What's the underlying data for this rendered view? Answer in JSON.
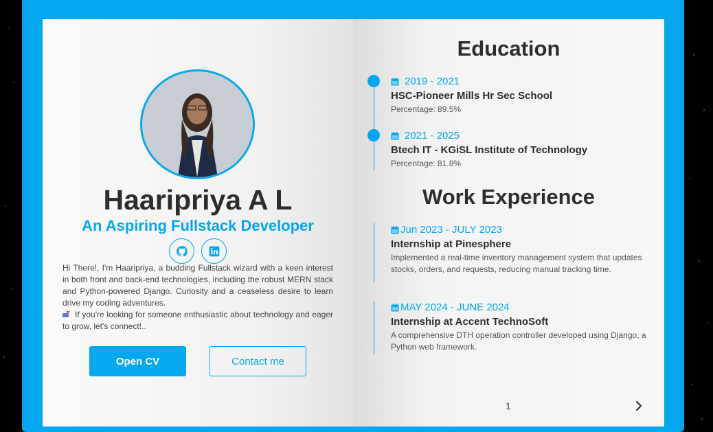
{
  "profile": {
    "name": "Haaripriya A L",
    "role": "An Aspiring Fullstack Developer",
    "bio_p1": "Hi There!, I'm Haaripriya, a budding Fullstack wizard with a keen interest in both front and back-end technologies, including the robust MERN stack and Python-powered Django. Curiosity and a ceaseless desire to learn drive my coding adventures.",
    "bio_p2": "If you're looking for someone enthusiastic about technology and eager to grow, let's connect!.."
  },
  "social": {
    "github_icon": "github-icon",
    "linkedin_icon": "linkedin-icon"
  },
  "buttons": {
    "open_cv": "Open CV",
    "contact": "Contact me"
  },
  "education": {
    "title": "Education",
    "items": [
      {
        "date": "2019 - 2021",
        "title": "HSC-Pioneer Mills Hr Sec School",
        "detail": "Percentage: 89.5%"
      },
      {
        "date": "2021 - 2025",
        "title": "Btech IT - KGiSL Institute of Technology",
        "detail": "Percentage: 81.8%"
      }
    ]
  },
  "work": {
    "title": "Work Experience",
    "items": [
      {
        "date": "Jun 2023 - JULY 2023",
        "title": "Internship at Pinesphere",
        "detail": "Implemented a real-time inventory management system that updates stocks, orders, and requests, reducing manual tracking time."
      },
      {
        "date": "MAY 2024 - JUNE 2024",
        "title": "Internship at Accent TechnoSoft",
        "detail": "A comprehensive DTH operation controller developed using Django, a Python web framework."
      }
    ]
  },
  "pagination": {
    "page": "1"
  },
  "colors": {
    "accent": "#05a7ee",
    "text": "#2d2d2d"
  }
}
